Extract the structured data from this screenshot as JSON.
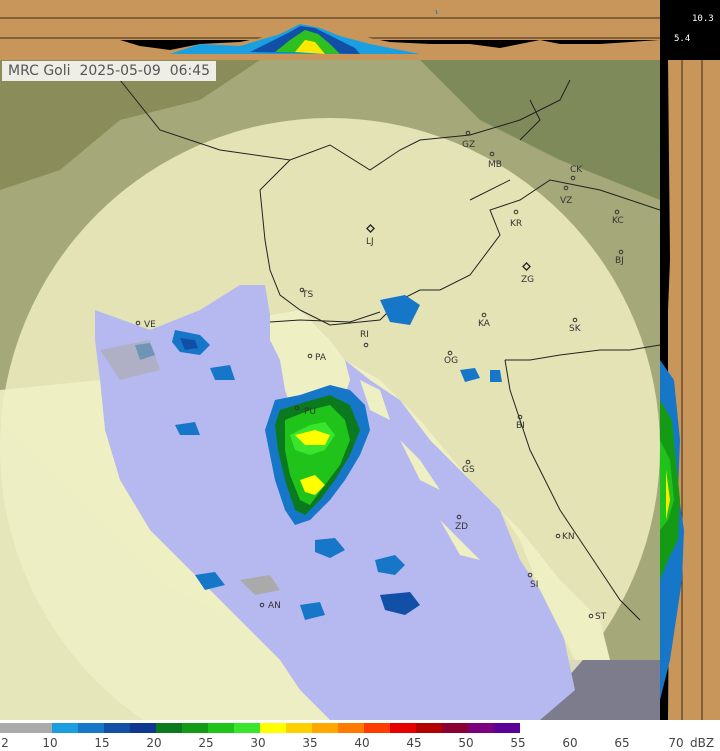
{
  "header": {
    "radar": "MRC Goli",
    "date": "2025-05-09",
    "time": "06:45"
  },
  "profile_scale": {
    "top": "10.3",
    "bottom": "5.4"
  },
  "cities": [
    {
      "code": "GZ"
    },
    {
      "code": "MB"
    },
    {
      "code": "CK"
    },
    {
      "code": "VZ"
    },
    {
      "code": "KR"
    },
    {
      "code": "KC"
    },
    {
      "code": "LJ",
      "capital": true
    },
    {
      "code": "ZG",
      "capital": true
    },
    {
      "code": "BJ"
    },
    {
      "code": "TS"
    },
    {
      "code": "VE"
    },
    {
      "code": "RI"
    },
    {
      "code": "KA"
    },
    {
      "code": "SK"
    },
    {
      "code": "PA"
    },
    {
      "code": "OG"
    },
    {
      "code": "PU"
    },
    {
      "code": "BI"
    },
    {
      "code": "GS"
    },
    {
      "code": "ZD"
    },
    {
      "code": "KN"
    },
    {
      "code": "SI"
    },
    {
      "code": "AN"
    },
    {
      "code": "ST"
    }
  ],
  "legend": {
    "unit": "dBZ",
    "ticks": [
      "2",
      "10",
      "15",
      "20",
      "25",
      "30",
      "35",
      "40",
      "45",
      "50",
      "55",
      "60",
      "65",
      "70"
    ],
    "colors": [
      "#aaaaaa",
      "#aaaaaa",
      "#1a9ee0",
      "#1677c9",
      "#1250a8",
      "#0e3890",
      "#0b7a1e",
      "#159a16",
      "#1fc31a",
      "#39e62c",
      "#ffff00",
      "#ffd000",
      "#ffa800",
      "#ff7a00",
      "#ff3c00",
      "#e60000",
      "#b40000",
      "#8a0033",
      "#7a0080",
      "#5a0098"
    ]
  }
}
